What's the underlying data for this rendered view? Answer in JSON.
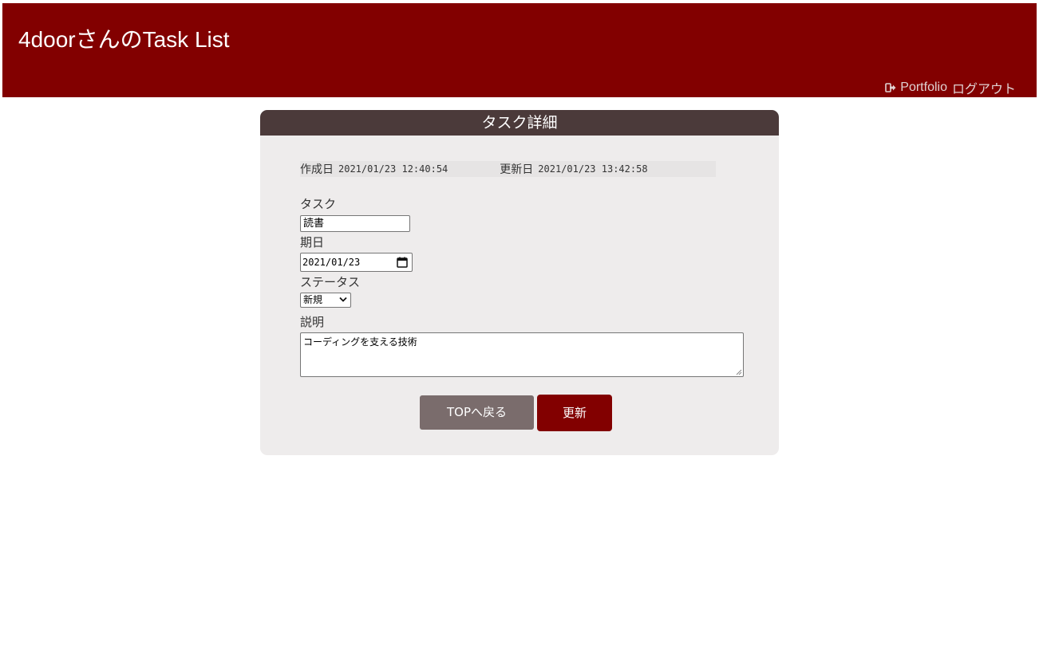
{
  "header": {
    "app_title": "4doorさんのTask List",
    "nav": {
      "portfolio_label": "Portfolio",
      "logout_label": "ログアウト",
      "logout_icon": "sign-out-icon"
    },
    "bg_color": "#820000"
  },
  "card": {
    "title": "タスク詳細",
    "header_color": "#4b3a3a",
    "meta": {
      "created_label": "作成日",
      "created_value": "2021/01/23 12:40:54",
      "updated_label": "更新日",
      "updated_value": "2021/01/23 13:42:58"
    },
    "fields": {
      "task_label": "タスク",
      "task_value": "読書",
      "due_label": "期日",
      "due_value": "2021/01/23",
      "status_label": "ステータス",
      "status_value": "新規",
      "description_label": "説明",
      "description_value": "コーディングを支える技術"
    },
    "buttons": {
      "back_label": "TOPへ戻る",
      "update_label": "更新"
    }
  }
}
